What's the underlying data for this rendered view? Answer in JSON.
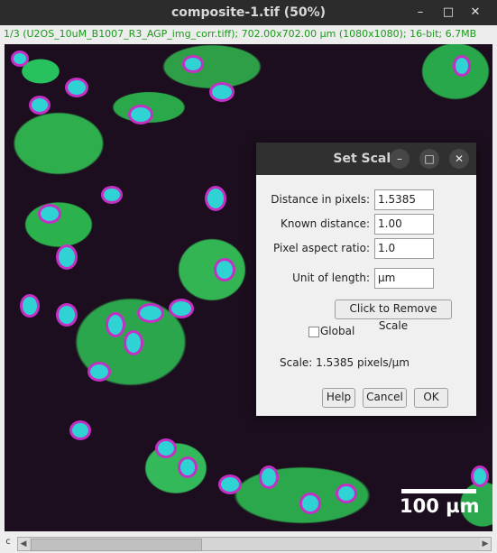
{
  "window": {
    "title": "composite-1.tif (50%)",
    "info": "1/3 (U2OS_10uM_B1007_R3_AGP_img_corr.tiff); 702.00x702.00 µm (1080x1080); 16-bit; 6.7MB",
    "minimize_icon": "–",
    "maximize_icon": "□",
    "close_icon": "✕"
  },
  "image": {
    "scale_bar_label": "100 µm"
  },
  "scrollbar": {
    "channel_label": "c",
    "left_arrow": "◀",
    "right_arrow": "▶"
  },
  "dialog": {
    "title": "Set Scale",
    "minimize_icon": "–",
    "maximize_icon": "□",
    "close_icon": "✕",
    "fields": {
      "distance_label": "Distance in pixels:",
      "distance_value": "1.5385",
      "known_label": "Known distance:",
      "known_value": "1.00",
      "aspect_label": "Pixel aspect ratio:",
      "aspect_value": "1.0",
      "unit_label": "Unit of length:",
      "unit_value": "µm"
    },
    "remove_scale_button": "Click to Remove Scale",
    "global_label": "Global",
    "global_checked": false,
    "scale_info": "Scale: 1.5385 pixels/µm",
    "help_button": "Help",
    "cancel_button": "Cancel",
    "ok_button": "OK"
  }
}
